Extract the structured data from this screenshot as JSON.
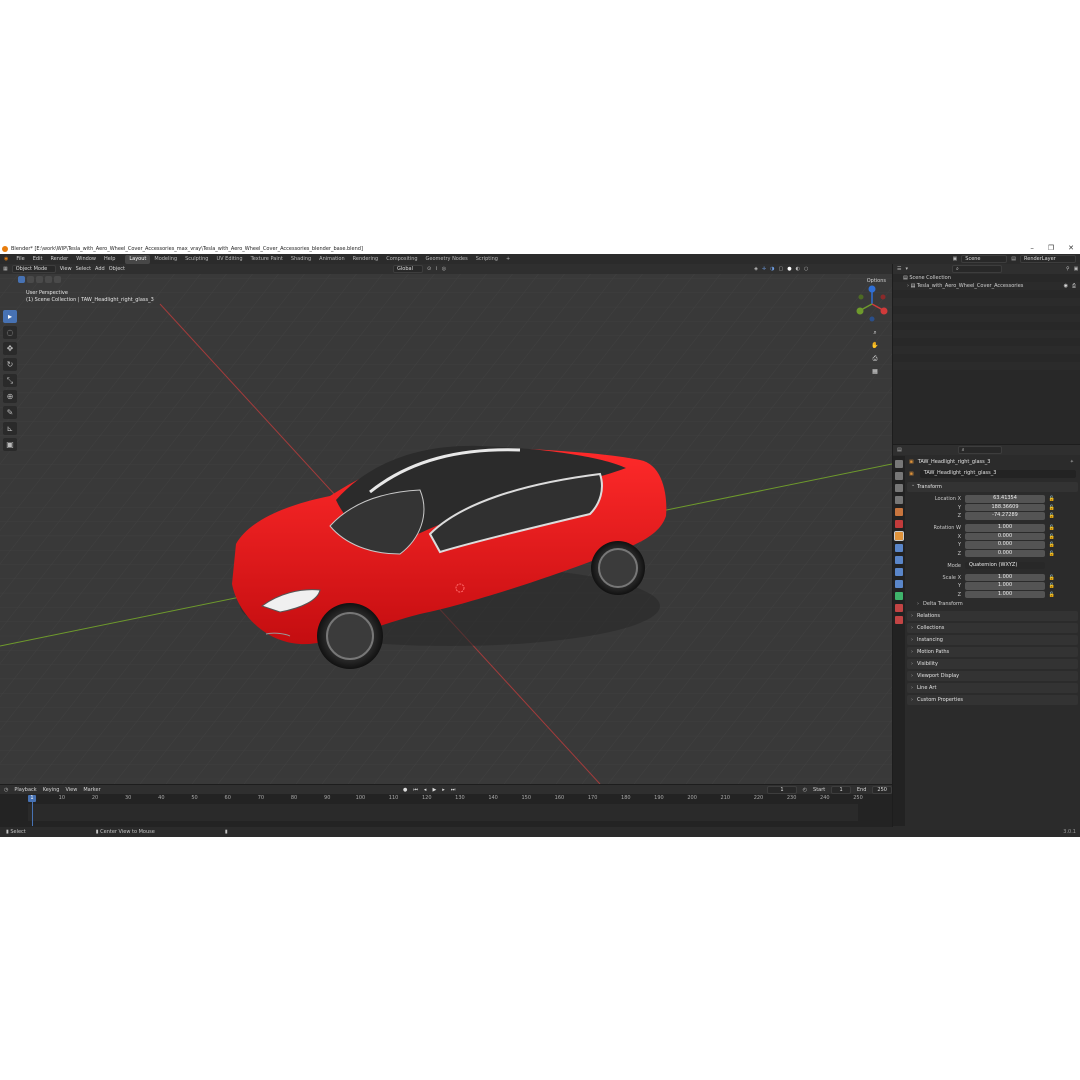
{
  "window": {
    "title": "Blender* [E:\\work\\WIP\\Tesla_with_Aero_Wheel_Cover_Accessories_max_vray\\Tesla_with_Aero_Wheel_Cover_Accessories_blender_base.blend]",
    "minimize": "–",
    "maximize": "❐",
    "close": "✕"
  },
  "menu": {
    "items": [
      "File",
      "Edit",
      "Render",
      "Window",
      "Help"
    ],
    "workspaces": [
      "Layout",
      "Modeling",
      "Sculpting",
      "UV Editing",
      "Texture Paint",
      "Shading",
      "Animation",
      "Rendering",
      "Compositing",
      "Geometry Nodes",
      "Scripting",
      "+"
    ],
    "active_workspace": "Layout",
    "scene": "Scene",
    "view_layer": "RenderLayer"
  },
  "viewport": {
    "mode": "Object Mode",
    "menus": [
      "View",
      "Select",
      "Add",
      "Object"
    ],
    "orientation": "Global",
    "options": "Options",
    "info_line1": "User Perspective",
    "info_line2": "(1) Scene Collection | TAW_Headlight_right_glass_3"
  },
  "timeline": {
    "menus": [
      "Playback",
      "Keying",
      "View",
      "Marker"
    ],
    "current_frame": "1",
    "start_label": "Start",
    "start": "1",
    "end_label": "End",
    "end": "250",
    "current_marker": "1",
    "ticks": [
      "10",
      "20",
      "30",
      "40",
      "50",
      "60",
      "70",
      "80",
      "90",
      "100",
      "110",
      "120",
      "130",
      "140",
      "150",
      "160",
      "170",
      "180",
      "190",
      "200",
      "210",
      "220",
      "230",
      "240",
      "250"
    ]
  },
  "statusbar": {
    "select": "Select",
    "center_view": "Center View to Mouse",
    "version": "3.0.1"
  },
  "outliner": {
    "root": "Scene Collection",
    "child": "Tesla_with_Aero_Wheel_Cover_Accessories"
  },
  "properties": {
    "object_name": "TAW_Headlight_right_glass_3",
    "name_field": "TAW_Headlight_right_glass_3",
    "transform_title": "Transform",
    "rows": [
      {
        "label": "Location X",
        "value": "63.41354"
      },
      {
        "label": "Y",
        "value": "188.36609"
      },
      {
        "label": "Z",
        "value": "-74.27289"
      },
      {
        "label": "Rotation W",
        "value": "1.000"
      },
      {
        "label": "X",
        "value": "0.000"
      },
      {
        "label": "Y",
        "value": "0.000"
      },
      {
        "label": "Z",
        "value": "0.000"
      }
    ],
    "mode_label": "Mode",
    "mode_value": "Quaternion (WXYZ)",
    "scale_rows": [
      {
        "label": "Scale X",
        "value": "1.000"
      },
      {
        "label": "Y",
        "value": "1.000"
      },
      {
        "label": "Z",
        "value": "1.000"
      }
    ],
    "delta_transform": "Delta Transform",
    "panels": [
      "Relations",
      "Collections",
      "Instancing",
      "Motion Paths",
      "Visibility",
      "Viewport Display",
      "Line Art",
      "Custom Properties"
    ]
  },
  "colors": {
    "car_body": "#e8171b",
    "accent": "#4772b3",
    "x_axis": "#a33b3b",
    "y_axis": "#6e9a2c"
  }
}
